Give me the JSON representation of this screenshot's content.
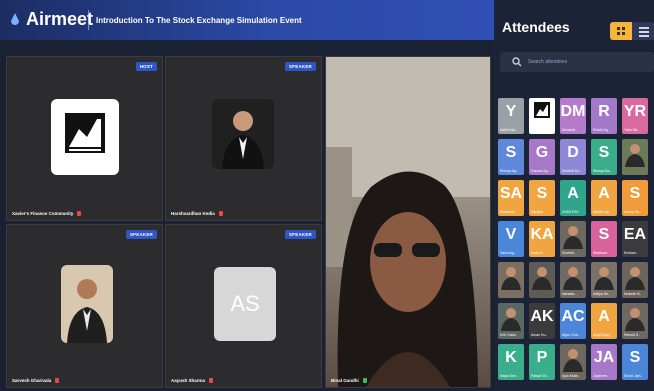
{
  "app": {
    "name": "Airmeet",
    "event_title": "Introduction To The Stock Exchange Simulation Event"
  },
  "tiles": [
    {
      "role": "HOST",
      "name": "Xavier's Finance Community"
    },
    {
      "role": "SPEAKER",
      "name": "Harshvardhan Kedia"
    },
    {
      "role": "SPEAKER",
      "name": "Sarvesh Gharivala"
    },
    {
      "role": "SPEAKER",
      "name": "Aayush Sharma",
      "initials": "AS"
    },
    {
      "role": "SPEAKER",
      "name": "Binal Gandhi"
    }
  ],
  "sidebar": {
    "title": "Attendees",
    "search_placeholder": "Search attendees"
  },
  "attendees": [
    {
      "i": "Y",
      "name": "Vaibhl Ma..",
      "color": "#9aa0a6"
    },
    {
      "i": "",
      "name": "Xavier's F..",
      "color": "#ffffff",
      "photo": "logo"
    },
    {
      "i": "DM",
      "name": "Devandt..",
      "color": "#b67acb"
    },
    {
      "i": "R",
      "name": "Rutvik Ag..",
      "color": "#a278c9"
    },
    {
      "i": "YR",
      "name": "Yatin Mk..",
      "color": "#d86aa0"
    },
    {
      "i": "S",
      "name": "Shreya Ag..",
      "color": "#5f88da"
    },
    {
      "i": "G",
      "name": "Gaurav Ag..",
      "color": "#a678c7"
    },
    {
      "i": "D",
      "name": "Devesh Mi..",
      "color": "#8e87d6"
    },
    {
      "i": "S",
      "name": "Shreya Sa..",
      "color": "#3aae8b"
    },
    {
      "i": "",
      "name": "",
      "color": "#6b7b5a",
      "photo": "person"
    },
    {
      "i": "SA",
      "name": "Shashil A..",
      "color": "#f0a541"
    },
    {
      "i": "S",
      "name": "Sangita",
      "color": "#f0a541"
    },
    {
      "i": "A",
      "name": "AYAN RAY",
      "color": "#2fa58b"
    },
    {
      "i": "A",
      "name": "Ashish Ag..",
      "color": "#f0a541"
    },
    {
      "i": "S",
      "name": "Akhay Sa..",
      "color": "#f29b3a"
    },
    {
      "i": "V",
      "name": "Vashi Ag..",
      "color": "#4c86d9"
    },
    {
      "i": "KA",
      "name": "Ansh K..",
      "color": "#f0a541"
    },
    {
      "i": "",
      "name": "Shobhit..",
      "color": "#6d6860",
      "photo": "person"
    },
    {
      "i": "S",
      "name": "Siddhant..",
      "color": "#d9629a"
    },
    {
      "i": "EA",
      "name": "Eeshan..",
      "color": "#3b3b3e"
    },
    {
      "i": "",
      "name": "",
      "color": "#7d6e62",
      "photo": "person"
    },
    {
      "i": "",
      "name": "",
      "color": "#5e5a55",
      "photo": "person"
    },
    {
      "i": "",
      "name": "Nandita..",
      "color": "#6f6a63",
      "photo": "person"
    },
    {
      "i": "",
      "name": "Aditya Sh..",
      "color": "#7a7169",
      "photo": "person"
    },
    {
      "i": "",
      "name": "Mukesh B..",
      "color": "#6c655c",
      "photo": "person"
    },
    {
      "i": "",
      "name": "Kriti Gaba..",
      "color": "#5b6763",
      "photo": "person"
    },
    {
      "i": "AK",
      "name": "Aman Ku..",
      "color": "#3b3b3e"
    },
    {
      "i": "AC",
      "name": "Arjun Cha..",
      "color": "#4c86d9"
    },
    {
      "i": "A",
      "name": "Anjali Sag..",
      "color": "#f0a541"
    },
    {
      "i": "",
      "name": "Ranvid S..",
      "color": "#6d6860",
      "photo": "person"
    },
    {
      "i": "K",
      "name": "Kalpa Sen..",
      "color": "#3aae8b"
    },
    {
      "i": "P",
      "name": "Pallavi Sh..",
      "color": "#3aae8b"
    },
    {
      "i": "",
      "name": "Ayla Mukh..",
      "color": "#6d6860",
      "photo": "person"
    },
    {
      "i": "JA",
      "name": "Jayshree..",
      "color": "#a678c7"
    },
    {
      "i": "S",
      "name": "Shruti Jain..",
      "color": "#4c86d9"
    }
  ]
}
